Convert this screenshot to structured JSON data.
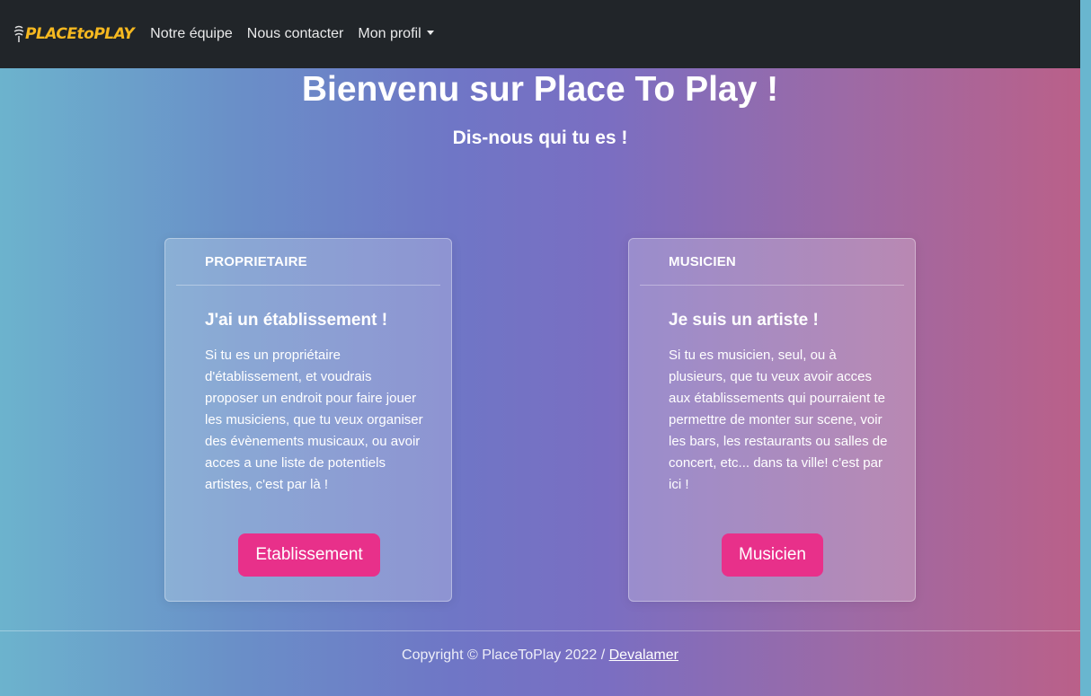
{
  "navbar": {
    "brand": "PLACEtoPLAY",
    "links": [
      "Notre équipe",
      "Nous contacter",
      "Mon profil"
    ]
  },
  "hero": {
    "title": "Bienvenu sur Place To Play !",
    "subtitle": "Dis-nous qui tu es !"
  },
  "cards": [
    {
      "header": "PROPRIETAIRE",
      "title": "J'ai un établissement !",
      "text": "Si tu es un propriétaire d'établissement, et voudrais proposer un endroit pour faire jouer les musiciens, que tu veux organiser des évènements musicaux, ou avoir acces a une liste de potentiels artistes, c'est par là !",
      "button": "Etablissement"
    },
    {
      "header": "MUSICIEN",
      "title": "Je suis un artiste !",
      "text": "Si tu es musicien, seul, ou à plusieurs, que tu veux avoir acces aux établissements qui pourraient te permettre de monter sur scene, voir les bars, les restaurants ou salles de concert, etc... dans ta ville! c'est par ici !",
      "button": "Musicien"
    }
  ],
  "footer": {
    "copyright": "Copyright © PlaceToPlay 2022 / ",
    "link": "Devalamer"
  },
  "colors": {
    "navbar": "#212529",
    "brand": "#f5b820",
    "button": "#e8308a"
  }
}
